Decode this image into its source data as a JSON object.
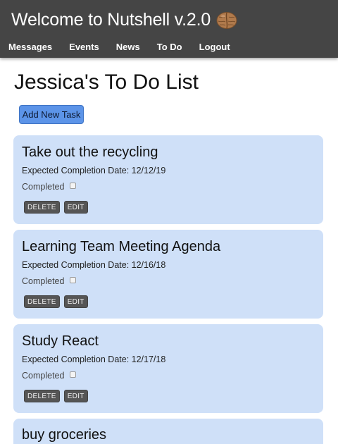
{
  "header": {
    "title": "Welcome to Nutshell v.2.0",
    "logo_icon": "walnut-icon",
    "bg_color": "#454545"
  },
  "nav": {
    "items": [
      {
        "label": "Messages"
      },
      {
        "label": "Events"
      },
      {
        "label": "News"
      },
      {
        "label": "To Do"
      },
      {
        "label": "Logout"
      }
    ]
  },
  "main": {
    "page_title": "Jessica's To Do List",
    "add_button_label": "Add New Task",
    "accent_color": "#5c94e8",
    "card_color": "#cfe0f8"
  },
  "tasks": [
    {
      "title": "Take out the recycling",
      "date_text": "Expected Completion Date: 12/12/19",
      "completed_label": "Completed",
      "completed": false,
      "delete_label": "DELETE",
      "edit_label": "EDIT"
    },
    {
      "title": "Learning Team Meeting Agenda",
      "date_text": "Expected Completion Date: 12/16/18",
      "completed_label": "Completed",
      "completed": false,
      "delete_label": "DELETE",
      "edit_label": "EDIT"
    },
    {
      "title": "Study React",
      "date_text": "Expected Completion Date: 12/17/18",
      "completed_label": "Completed",
      "completed": false,
      "delete_label": "DELETE",
      "edit_label": "EDIT"
    },
    {
      "title": "buy groceries"
    }
  ]
}
